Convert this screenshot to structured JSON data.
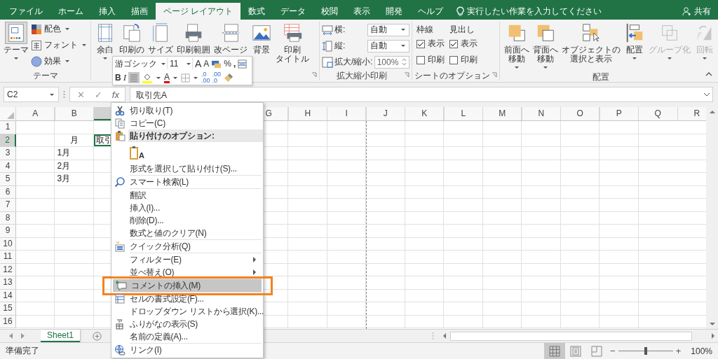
{
  "tabs": [
    {
      "label": "ファイル",
      "selected": false
    },
    {
      "label": "ホーム",
      "selected": false
    },
    {
      "label": "挿入",
      "selected": false
    },
    {
      "label": "描画",
      "selected": false
    },
    {
      "label": "ページ レイアウト",
      "selected": true
    },
    {
      "label": "数式",
      "selected": false
    },
    {
      "label": "データ",
      "selected": false
    },
    {
      "label": "校閲",
      "selected": false
    },
    {
      "label": "表示",
      "selected": false
    },
    {
      "label": "開発",
      "selected": false
    },
    {
      "label": "ヘルプ",
      "selected": false
    }
  ],
  "tell_me": "実行したい作業を入力してください",
  "share": "共有",
  "ribbon": {
    "theme_group": {
      "label": "テーマ",
      "big": {
        "lines": [
          "テーマ"
        ],
        "caret": true
      },
      "small": [
        {
          "label": "配色",
          "caret": true
        },
        {
          "label": "フォント",
          "caret": true
        },
        {
          "label": "効果",
          "caret": true
        }
      ]
    },
    "page_setup": {
      "buttons": [
        {
          "lines": [
            "余白"
          ],
          "caret": true,
          "disabled": false
        },
        {
          "lines": [
            "印刷の"
          ],
          "caret": false,
          "disabled": false
        },
        {
          "lines": [
            "サイズ"
          ],
          "caret": false,
          "disabled": false
        },
        {
          "lines": [
            "印刷範囲"
          ],
          "caret": false,
          "disabled": false
        },
        {
          "lines": [
            "改ページ"
          ],
          "caret": false,
          "disabled": false
        },
        {
          "lines": [
            "背景"
          ],
          "caret": false,
          "disabled": false
        },
        {
          "lines": [
            "印刷",
            "タイトル"
          ],
          "caret": false,
          "disabled": false
        }
      ]
    },
    "scale": {
      "label": "拡大縮小印刷",
      "rows": [
        {
          "kind": "dropdown",
          "label": "横:",
          "value": "自動"
        },
        {
          "kind": "dropdown",
          "label": "縦:",
          "value": "自動"
        },
        {
          "kind": "spinner",
          "label": "拡大/縮小:",
          "value": "100%"
        }
      ]
    },
    "sheet_options": {
      "label": "シートのオプション",
      "columns": [
        {
          "title": "枠線",
          "show": {
            "label": "表示",
            "checked": true
          },
          "print": {
            "label": "印刷",
            "checked": false
          }
        },
        {
          "title": "見出し",
          "show": {
            "label": "表示",
            "checked": true
          },
          "print": {
            "label": "印刷",
            "checked": false
          }
        }
      ]
    },
    "arrange": {
      "label": "配置",
      "buttons": [
        {
          "lines": [
            "前面へ",
            "移動"
          ],
          "caret": true,
          "disabled": false
        },
        {
          "lines": [
            "背面へ",
            "移動"
          ],
          "caret": true,
          "disabled": false
        },
        {
          "lines": [
            "オブジェクトの",
            "選択と表示"
          ],
          "caret": false,
          "disabled": false
        },
        {
          "lines": [
            "配置"
          ],
          "caret": true,
          "disabled": false
        },
        {
          "lines": [
            "グループ化"
          ],
          "caret": true,
          "disabled": true
        },
        {
          "lines": [
            "回転"
          ],
          "caret": true,
          "disabled": true
        }
      ]
    }
  },
  "mini_toolbar": {
    "font": "游ゴシック",
    "size": "11",
    "grow": "A",
    "shrink": "A",
    "percent": "%",
    "comma": ",",
    "bold": "B",
    "italic": "I",
    "font_color": "A",
    "decimals": [
      {
        "top": ".0",
        "bottom": ".00"
      },
      {
        "top": ".00",
        "bottom": ".0"
      }
    ]
  },
  "formula_bar": {
    "name_box": "C2",
    "cancel": "✕",
    "enter": "✓",
    "fx": "fx",
    "content": "取引先A"
  },
  "sheet": {
    "columns": [
      {
        "label": "A",
        "selected": false
      },
      {
        "label": "B",
        "selected": false
      },
      {
        "selected": true
      },
      {
        "label": "G",
        "selected": false
      },
      {
        "label": "H",
        "selected": false
      },
      {
        "label": "I",
        "selected": false
      },
      {
        "label": "J",
        "selected": false
      },
      {
        "label": "K",
        "selected": false
      },
      {
        "label": "L",
        "selected": false
      },
      {
        "label": "M",
        "selected": false
      },
      {
        "label": "N",
        "selected": false
      },
      {
        "label": "O",
        "selected": false
      },
      {
        "label": "P",
        "selected": false
      },
      {
        "label": "Q",
        "selected": false
      },
      {
        "label": "R",
        "selected": false
      }
    ],
    "rows": [
      {
        "label": "1",
        "selected": false
      },
      {
        "label": "2",
        "selected": true,
        "B": {
          "text": "月",
          "centered": true,
          "active": false
        },
        "C": {
          "text": "取引",
          "centered": false,
          "active": true
        }
      },
      {
        "label": "3",
        "selected": false,
        "B": {
          "text": "1月",
          "centered": false,
          "active": false
        }
      },
      {
        "label": "4",
        "selected": false,
        "B": {
          "text": "2月",
          "centered": false,
          "active": false
        }
      },
      {
        "label": "5",
        "selected": false,
        "B": {
          "text": "3月",
          "centered": false,
          "active": false
        }
      },
      {
        "label": "6",
        "selected": false
      },
      {
        "label": "7",
        "selected": false
      },
      {
        "label": "8",
        "selected": false
      },
      {
        "label": "9",
        "selected": false
      },
      {
        "label": "10",
        "selected": false
      },
      {
        "label": "11",
        "selected": false
      },
      {
        "label": "12",
        "selected": false
      },
      {
        "label": "13",
        "selected": false
      },
      {
        "label": "14",
        "selected": false
      },
      {
        "label": "15",
        "selected": false
      },
      {
        "label": "16",
        "selected": false
      }
    ]
  },
  "sheet_tabs": [
    {
      "label": "Sheet1",
      "selected": true
    }
  ],
  "context_menu": {
    "items": [
      {
        "kind": "item",
        "label": "切り取り(T)",
        "divider_above": false,
        "submenu": false,
        "selected": false,
        "highlighted": false
      },
      {
        "kind": "item",
        "label": "コピー(C)",
        "divider_above": false,
        "submenu": false,
        "selected": false,
        "highlighted": false
      },
      {
        "kind": "header",
        "label": "貼り付けのオプション:",
        "divider_above": false
      },
      {
        "kind": "paste_options",
        "label": "A",
        "divider_above": false
      },
      {
        "kind": "item",
        "label": "形式を選択して貼り付け(S)...",
        "divider_above": false,
        "submenu": false,
        "selected": false,
        "highlighted": false
      },
      {
        "kind": "item",
        "label": "スマート検索(L)",
        "divider_above": true,
        "submenu": false,
        "selected": false,
        "highlighted": false
      },
      {
        "kind": "item",
        "label": "翻訳",
        "divider_above": true,
        "submenu": false,
        "selected": false,
        "highlighted": false
      },
      {
        "kind": "item",
        "label": "挿入(I)...",
        "divider_above": false,
        "submenu": false,
        "selected": false,
        "highlighted": false
      },
      {
        "kind": "item",
        "label": "削除(D)...",
        "divider_above": false,
        "submenu": false,
        "selected": false,
        "highlighted": false
      },
      {
        "kind": "item",
        "label": "数式と値のクリア(N)",
        "divider_above": false,
        "submenu": false,
        "selected": false,
        "highlighted": false
      },
      {
        "kind": "item",
        "label": "クイック分析(Q)",
        "divider_above": true,
        "submenu": false,
        "selected": false,
        "highlighted": false
      },
      {
        "kind": "item",
        "label": "フィルター(E)",
        "divider_above": true,
        "submenu": true,
        "selected": false,
        "highlighted": false
      },
      {
        "kind": "item",
        "label": "並べ替え(O)",
        "divider_above": false,
        "submenu": true,
        "selected": false,
        "highlighted": false
      },
      {
        "kind": "item",
        "label": "コメントの挿入(M)",
        "divider_above": true,
        "submenu": false,
        "selected": true,
        "highlighted": true
      },
      {
        "kind": "item",
        "label": "セルの書式設定(F)...",
        "divider_above": true,
        "submenu": false,
        "selected": false,
        "highlighted": false
      },
      {
        "kind": "item",
        "label": "ドロップダウン リストから選択(K)...",
        "divider_above": false,
        "submenu": false,
        "selected": false,
        "highlighted": false
      },
      {
        "kind": "item",
        "label": "ふりがなの表示(S)",
        "divider_above": false,
        "submenu": false,
        "selected": false,
        "highlighted": false
      },
      {
        "kind": "item",
        "label": "名前の定義(A)...",
        "divider_above": false,
        "submenu": false,
        "selected": false,
        "highlighted": false
      },
      {
        "kind": "item",
        "label": "リンク(I)",
        "divider_above": true,
        "submenu": false,
        "selected": false,
        "highlighted": false
      }
    ]
  },
  "status_bar": {
    "text": "準備完了",
    "views": [
      {
        "selected": true
      },
      {
        "selected": false
      },
      {
        "selected": false
      }
    ],
    "zoom_out": "−",
    "zoom_in": "+",
    "zoom": {
      "level": 0.5
    },
    "zoom_label": "100%"
  }
}
